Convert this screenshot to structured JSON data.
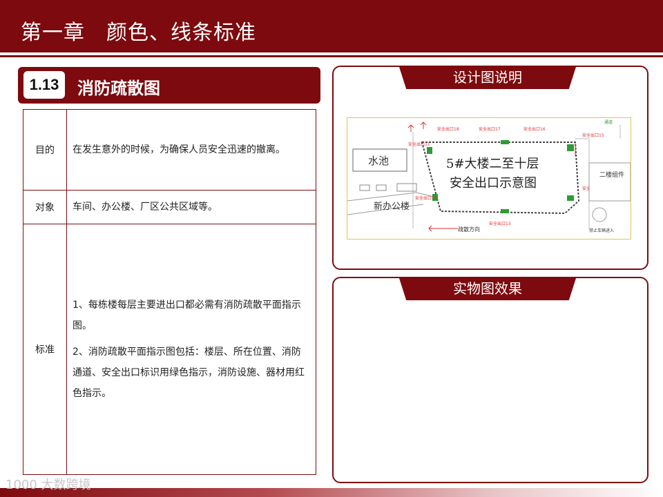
{
  "header": {
    "title": "第一章　颜色、线条标准"
  },
  "section": {
    "number": "1.13",
    "title": "消防疏散图"
  },
  "table": {
    "purpose_label": "目的",
    "purpose_text": "在发生意外的时候，为确保人员安全迅速的撤离。",
    "target_label": "对象",
    "target_text": "车间、办公楼、厂区公共区域等。",
    "standard_label": "标准",
    "standard_items": [
      "1、每栋楼每层主要进出口都必需有消防疏散平面指示图。",
      "2、消防疏散平面指示图包括：楼层、所在位置、消防通道、安全出口标识用绿色指示，消防设施、器材用红色指示。"
    ]
  },
  "design_panel": {
    "title": "设计图说明",
    "plan": {
      "pool": "水池",
      "main_title_1": "5#大楼二至十层",
      "main_title_2": "安全出口示意图",
      "new_office": "新办公楼",
      "building_2": "二楼组件",
      "direction": "疏散方向",
      "no_vehicle": "禁止车辆进入",
      "channel": "通道",
      "exits": [
        "安全出口18",
        "安全出口17",
        "安全出口16",
        "安全出口15",
        "安全出口14",
        "安全出口13",
        "安全出口12",
        "安全出口11"
      ]
    }
  },
  "real_panel": {
    "title": "实物图效果"
  },
  "watermark": "1000 大数跨境",
  "colors": {
    "brand": "#7d0a0e",
    "exit_green": "#2e9b3a",
    "exit_red": "#e03030"
  }
}
